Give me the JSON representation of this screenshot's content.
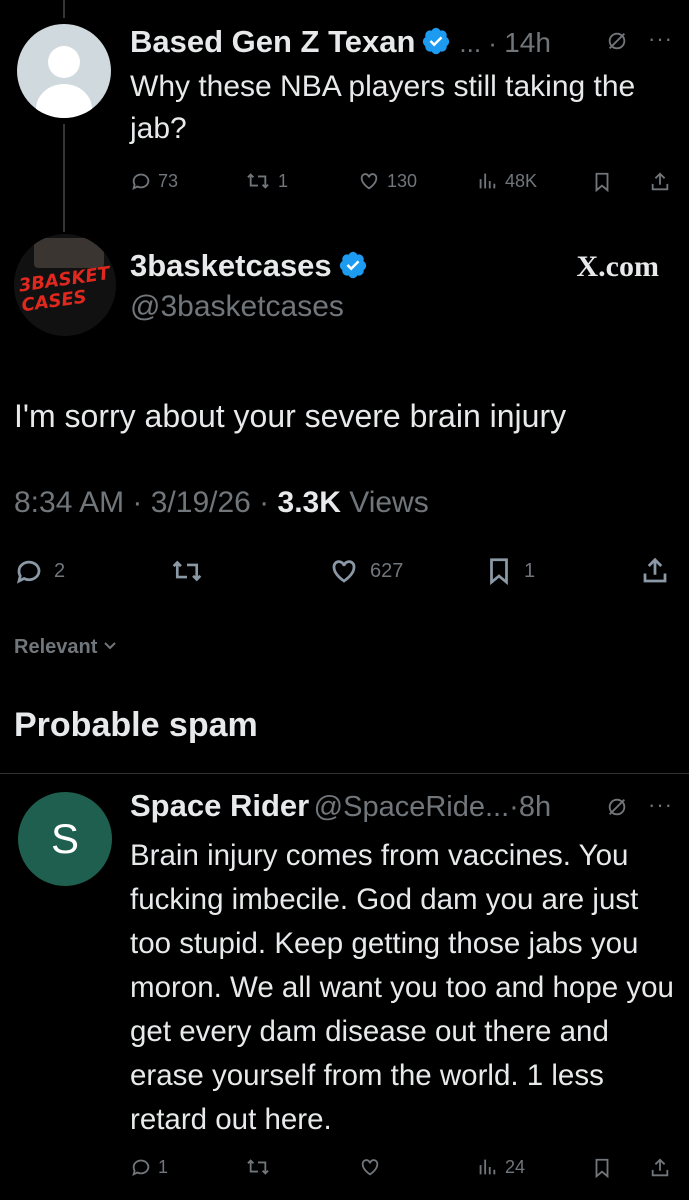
{
  "parent_tweet": {
    "display_name": "Based Gen Z Texan",
    "handle_truncated": "...",
    "time": "14h",
    "text": "Why these NBA players still taking the jab?",
    "stats": {
      "replies": "73",
      "reposts": "1",
      "likes": "130",
      "views": "48K"
    }
  },
  "main_tweet": {
    "display_name": "3basketcases",
    "handle": "@3basketcases",
    "source_label": "X.com",
    "avatar_text": "3BASKET CASES",
    "text": "I'm sorry about your severe brain injury",
    "time": "8:34 AM",
    "date": "3/19/26",
    "views_count": "3.3K",
    "views_label": "Views",
    "stats": {
      "replies": "2",
      "likes": "627",
      "bookmarks": "1"
    }
  },
  "sort": {
    "label": "Relevant"
  },
  "section_title": "Probable spam",
  "reply_tweet": {
    "avatar_letter": "S",
    "display_name": "Space Rider",
    "handle": "@SpaceRide...",
    "time": "8h",
    "text": "Brain injury comes from vaccines. You fucking imbecile. God dam you are just too stupid. Keep getting those jabs you moron. We all want you too and hope you get every dam disease out there and erase yourself from the world. 1 less retard out here.",
    "stats": {
      "replies": "1",
      "views": "24"
    }
  },
  "colors": {
    "background": "#000000",
    "verified": "#1d9bf0",
    "muted": "#71767b",
    "reply_avatar": "#1f5f4f"
  }
}
